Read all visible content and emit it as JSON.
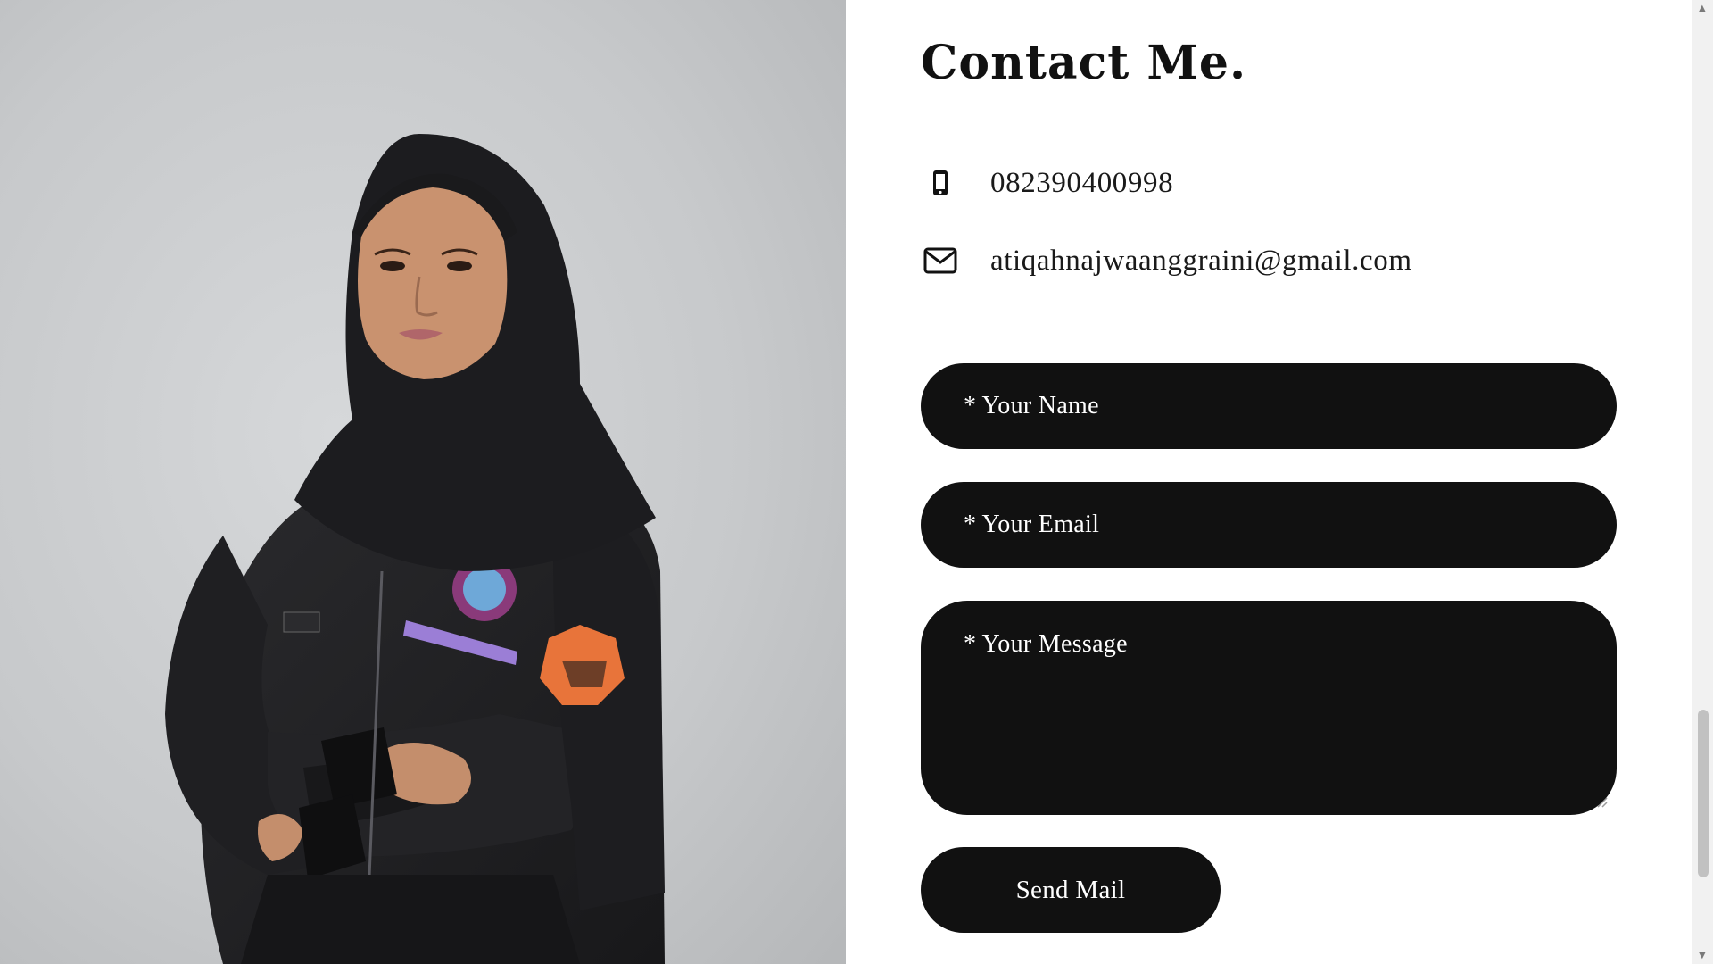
{
  "contact": {
    "title": "Contact Me.",
    "phone": {
      "icon": "smartphone-icon",
      "value": "082390400998"
    },
    "email": {
      "icon": "envelope-icon",
      "value": "atiqahnajwaanggraini@gmail.com"
    }
  },
  "form": {
    "name_placeholder": "* Your Name",
    "email_placeholder": "* Your Email",
    "message_placeholder": "* Your Message",
    "send_label": "Send Mail"
  },
  "photo": {
    "description": "profile-photo"
  },
  "colors": {
    "field_bg": "#111111",
    "field_text": "#ffffff",
    "accent_purple": "#9b7ed6",
    "patch_orange": "#e8743a"
  }
}
